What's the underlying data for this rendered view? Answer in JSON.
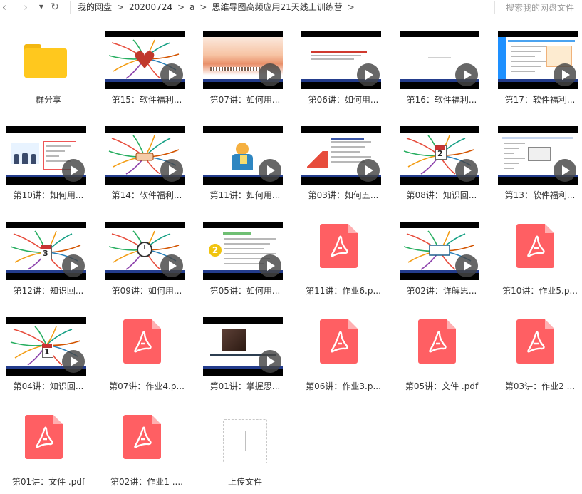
{
  "nav": {
    "back_glyph": "‹",
    "forward_glyph": "›",
    "dropdown_glyph": "▼",
    "refresh_glyph": "↻"
  },
  "breadcrumb": [
    "我的网盘",
    "20200724",
    "a",
    "思维导图高频应用21天线上训练营"
  ],
  "breadcrumb_sep": ">",
  "search": {
    "placeholder": "搜索我的网盘文件"
  },
  "items": [
    {
      "label": "群分享",
      "type": "folder"
    },
    {
      "label": "第15：软件福利...",
      "type": "video"
    },
    {
      "label": "第07讲：如何用...",
      "type": "video"
    },
    {
      "label": "第06讲：如何用...",
      "type": "video"
    },
    {
      "label": "第16：软件福利...",
      "type": "video"
    },
    {
      "label": "第17：软件福利...",
      "type": "video"
    },
    {
      "label": "第10讲：如何用...",
      "type": "video"
    },
    {
      "label": "第14：软件福利...",
      "type": "video"
    },
    {
      "label": "第11讲：如何用...",
      "type": "video"
    },
    {
      "label": "第03讲：如何五...",
      "type": "video"
    },
    {
      "label": "第08讲：知识回...",
      "type": "video"
    },
    {
      "label": "第13：软件福利...",
      "type": "video"
    },
    {
      "label": "第12讲：知识回...",
      "type": "video"
    },
    {
      "label": "第09讲：如何用...",
      "type": "video"
    },
    {
      "label": "第05讲：如何用...",
      "type": "video"
    },
    {
      "label": "第11讲：作业6.p...",
      "type": "pdf"
    },
    {
      "label": "第02讲：详解思...",
      "type": "video"
    },
    {
      "label": "第10讲：作业5.p...",
      "type": "pdf"
    },
    {
      "label": "第04讲：知识回...",
      "type": "video"
    },
    {
      "label": "第07讲：作业4.p...",
      "type": "pdf"
    },
    {
      "label": "第01讲：掌握思...",
      "type": "video"
    },
    {
      "label": "第06讲：作业3.p...",
      "type": "pdf"
    },
    {
      "label": "第05讲：文件 .pdf",
      "type": "pdf"
    },
    {
      "label": "第03讲：作业2 ...",
      "type": "pdf"
    },
    {
      "label": "第01讲：文件 .pdf",
      "type": "pdf"
    },
    {
      "label": "第02讲：作业1 ....",
      "type": "pdf"
    },
    {
      "label": "上传文件",
      "type": "upload"
    }
  ],
  "thumb_text": {
    "calendar_2": "2",
    "calendar_3": "3",
    "calendar_1": "1",
    "badge_2": "2"
  },
  "colors": {
    "pdf_red": "#ff5f63",
    "folder_yellow": "#ffc81e",
    "video_band": "#233c8c"
  }
}
